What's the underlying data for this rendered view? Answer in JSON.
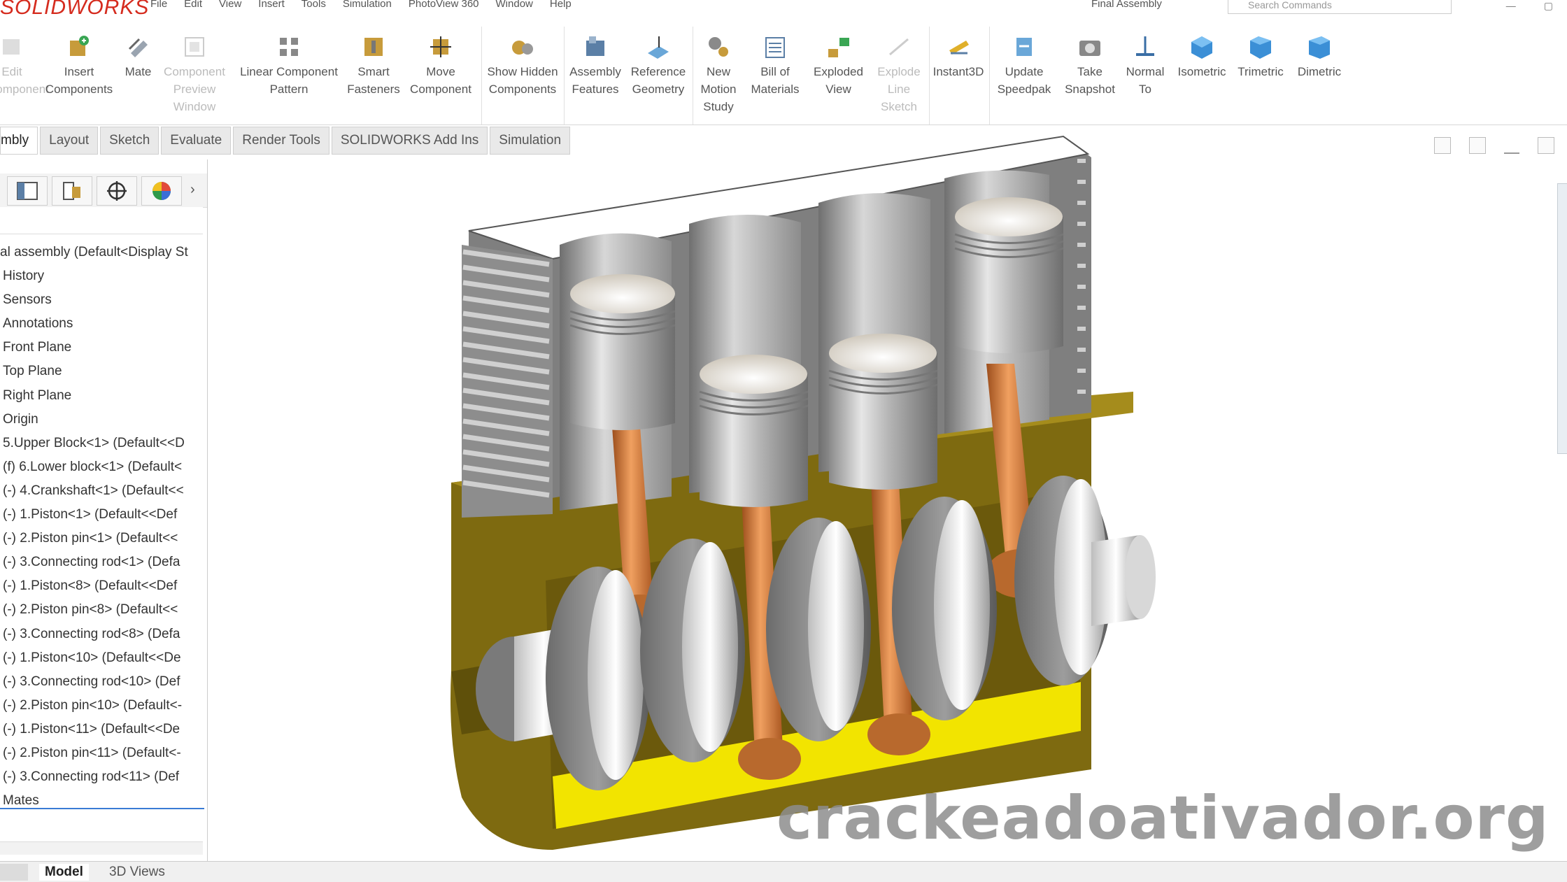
{
  "app": {
    "logo_bold": "SOLIDWORKS",
    "window_title": "Final Assembly"
  },
  "menu": [
    "File",
    "Edit",
    "View",
    "Insert",
    "Tools",
    "Simulation",
    "PhotoView 360",
    "Window",
    "Help"
  ],
  "search": {
    "placeholder": "Search Commands"
  },
  "ribbon": {
    "edit_component": "Edit Component",
    "insert_components": "Insert Components",
    "mate": "Mate",
    "component_preview": "Component Preview Window",
    "linear_pattern": "Linear Component Pattern",
    "smart_fasteners": "Smart Fasteners",
    "move_component": "Move Component",
    "show_hidden": "Show Hidden Components",
    "assembly_features": "Assembly Features",
    "reference_geometry": "Reference Geometry",
    "new_motion_study": "New Motion Study",
    "bill_of_materials": "Bill of Materials",
    "exploded_view": "Exploded View",
    "explode_line_sketch": "Explode Line Sketch",
    "instant3d": "Instant3D",
    "update_speedpak": "Update Speedpak",
    "take_snapshot": "Take Snapshot",
    "normal_to": "Normal To",
    "isometric": "Isometric",
    "trimetric": "Trimetric",
    "dimetric": "Dimetric"
  },
  "tabs": [
    "Assembly",
    "Layout",
    "Sketch",
    "Evaluate",
    "Render Tools",
    "SOLIDWORKS Add-Ins",
    "Simulation"
  ],
  "tabs_display": [
    "mbly",
    "Layout",
    "Sketch",
    "Evaluate",
    "Render Tools",
    "SOLIDWORKS Add Ins",
    "Simulation"
  ],
  "tree": [
    "al assembly  (Default<Display St",
    "History",
    "Sensors",
    "Annotations",
    "Front Plane",
    "Top Plane",
    "Right Plane",
    "Origin",
    "5.Upper Block<1> (Default<<D",
    "(f) 6.Lower block<1> (Default<",
    "(-) 4.Crankshaft<1> (Default<<",
    "(-) 1.Piston<1> (Default<<Def",
    "(-) 2.Piston pin<1> (Default<<",
    "(-) 3.Connecting rod<1> (Defa",
    "(-) 1.Piston<8> (Default<<Def",
    "(-) 2.Piston pin<8> (Default<<",
    "(-) 3.Connecting rod<8> (Defa",
    "(-) 1.Piston<10> (Default<<De",
    "(-) 3.Connecting rod<10> (Def",
    "(-) 2.Piston pin<10> (Default<-",
    "(-) 1.Piston<11> (Default<<De",
    "(-) 2.Piston pin<11> (Default<-",
    "(-) 3.Connecting rod<11> (Def",
    "Mates"
  ],
  "bottom_tabs": [
    "Model",
    "3D Views"
  ],
  "watermark": "crackeadoativador.org",
  "colors": {
    "block_gold": "#7e6a10",
    "oil_yellow": "#f2e400",
    "rod_copper": "#c8763a",
    "logo_red": "#d52b1e"
  }
}
